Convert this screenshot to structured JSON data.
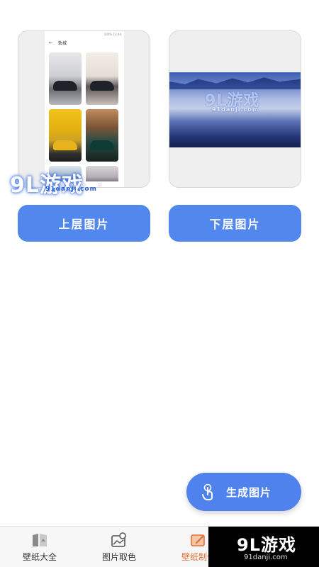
{
  "cards": {
    "left_preview": {
      "status_left": "",
      "status_right": "100% 13:44",
      "header_title": "轨械"
    }
  },
  "watermark": {
    "brand": "9L游戏",
    "site": "91danji.com"
  },
  "buttons": {
    "upper_image": "上层图片",
    "lower_image": "下层图片",
    "generate": "生成图片"
  },
  "bottom_nav": {
    "items": [
      {
        "label": "壁纸大全",
        "icon": "wallpaper-book-icon"
      },
      {
        "label": "图片取色",
        "icon": "image-color-picker-icon"
      },
      {
        "label": "壁纸制作",
        "icon": "wallpaper-edit-icon",
        "active": true
      }
    ]
  },
  "logo": {
    "main": "9L游戏",
    "sub": "91danji.com"
  },
  "colors": {
    "primary": "#5287ee",
    "active_tab": "#e2703a"
  }
}
